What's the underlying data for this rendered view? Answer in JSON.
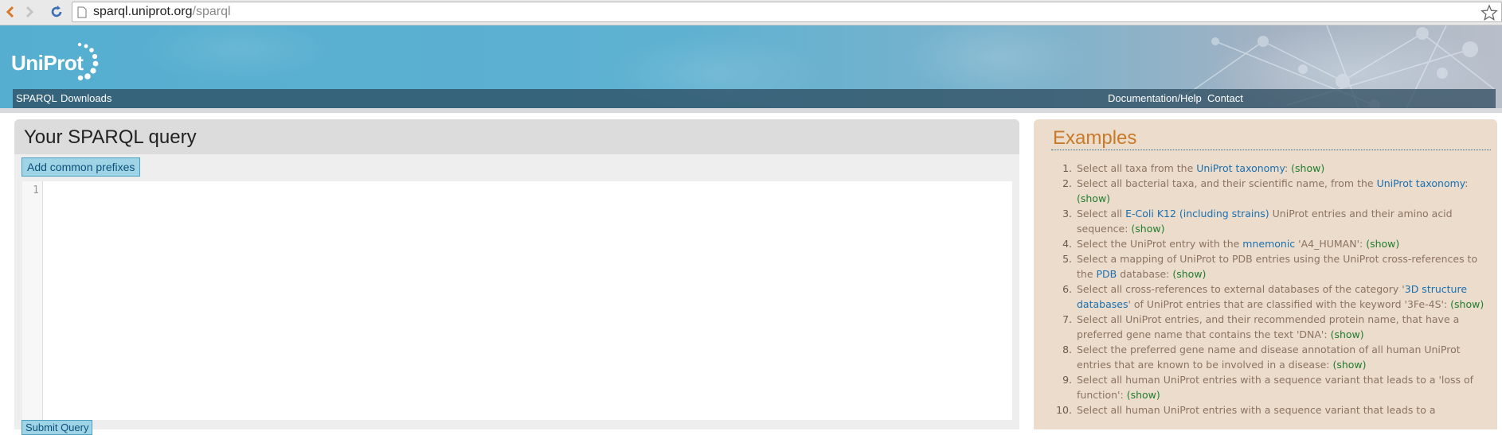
{
  "browser": {
    "url_host": "sparql.uniprot.org",
    "url_path": "/sparql"
  },
  "header": {
    "logo_text": "UniProt",
    "nav_left": [
      "SPARQL",
      "Downloads"
    ],
    "nav_right": [
      "Documentation/Help",
      "Contact"
    ]
  },
  "query": {
    "title": "Your SPARQL query",
    "add_prefixes_label": "Add common prefixes",
    "line_number": "1",
    "submit_label": "Submit Query"
  },
  "examples": {
    "title": "Examples",
    "show_label": "(show)",
    "items": [
      {
        "num": "1.",
        "pre": "Select all taxa from the ",
        "link": "UniProt taxonomy",
        "post": ": "
      },
      {
        "num": "2.",
        "pre": "Select all bacterial taxa, and their scientific name, from the ",
        "link": "UniProt taxonomy",
        "post": ": "
      },
      {
        "num": "3.",
        "pre": "Select all ",
        "link": "E-Coli K12 (including strains)",
        "post": " UniProt entries and their amino acid sequence: "
      },
      {
        "num": "4.",
        "pre": "Select the UniProt entry with the ",
        "link": "mnemonic",
        "post": " 'A4_HUMAN': "
      },
      {
        "num": "5.",
        "pre": "Select a mapping of UniProt to PDB entries using the UniProt cross-references to the ",
        "link": "PDB",
        "post": " database: "
      },
      {
        "num": "6.",
        "pre": "Select all cross-references to external databases of the category '",
        "link": "3D structure databases",
        "post": "' of UniProt entries that are classified with the keyword '3Fe-4S': "
      },
      {
        "num": "7.",
        "pre": "Select all UniProt entries, and their recommended protein name, that have a preferred gene name that contains the text 'DNA': ",
        "link": "",
        "post": ""
      },
      {
        "num": "8.",
        "pre": "Select the preferred gene name and disease annotation of all human UniProt entries that are known to be involved in a disease: ",
        "link": "",
        "post": ""
      },
      {
        "num": "9.",
        "pre": "Select all human UniProt entries with a sequence variant that leads to a 'loss of function': ",
        "link": "",
        "post": ""
      },
      {
        "num": "10.",
        "pre": "Select all human UniProt entries with a sequence variant that leads to a",
        "link": "",
        "post": "",
        "no_show": true
      }
    ]
  },
  "colors": {
    "banner": "#55aed0",
    "examples_bg": "#ecdccb",
    "examples_title": "#c77a2a",
    "link": "#1a6fb0",
    "show": "#1f7d2f"
  }
}
